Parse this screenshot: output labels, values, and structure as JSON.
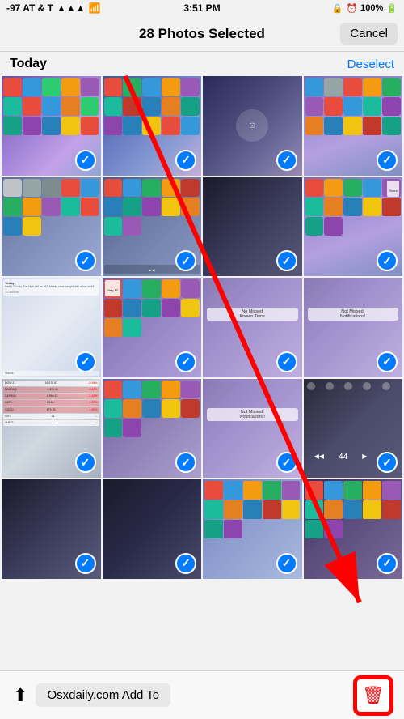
{
  "status_bar": {
    "carrier": "-97 AT & T",
    "signal_icon": "📶",
    "time": "3:51 PM",
    "lock_icon": "🔒",
    "alarm_icon": "⏰",
    "battery": "100%",
    "battery_icon": "🔋"
  },
  "nav": {
    "title": "28 Photos Selected",
    "cancel_label": "Cancel"
  },
  "section": {
    "label": "Today",
    "deselect_label": "Deselect"
  },
  "toolbar": {
    "share_label": "Share",
    "add_to_label": "Add To",
    "site_label": "Osxdaily.com",
    "delete_label": "Delete"
  },
  "photos": [
    {
      "id": 1,
      "theme": "purple-ios",
      "checked": true
    },
    {
      "id": 2,
      "theme": "blue-purple-ios",
      "checked": true
    },
    {
      "id": 3,
      "theme": "dark-ios",
      "checked": true
    },
    {
      "id": 4,
      "theme": "ios-apps",
      "checked": true
    },
    {
      "id": 5,
      "theme": "ios-apps2",
      "checked": true
    },
    {
      "id": 6,
      "theme": "ios-apps3",
      "checked": true
    },
    {
      "id": 7,
      "theme": "dark-ios2",
      "checked": true
    },
    {
      "id": 8,
      "theme": "ios-apps4",
      "checked": true
    },
    {
      "id": 9,
      "theme": "widget-today",
      "checked": true
    },
    {
      "id": 10,
      "theme": "ios-apps5",
      "checked": true
    },
    {
      "id": 11,
      "theme": "notification",
      "checked": true
    },
    {
      "id": 12,
      "theme": "notification2",
      "checked": true
    },
    {
      "id": 13,
      "theme": "stocks",
      "checked": true
    },
    {
      "id": 14,
      "theme": "ios-apps6",
      "checked": true
    },
    {
      "id": 15,
      "theme": "notification3",
      "checked": true
    },
    {
      "id": 16,
      "theme": "control-center",
      "checked": true
    },
    {
      "id": 17,
      "theme": "dark-ios3",
      "checked": true
    },
    {
      "id": 18,
      "theme": "dark-ios4",
      "checked": true
    },
    {
      "id": 19,
      "theme": "ios-apps7",
      "checked": true
    },
    {
      "id": 20,
      "theme": "control2",
      "checked": true
    }
  ],
  "arrow": {
    "visible": true,
    "color": "red"
  }
}
